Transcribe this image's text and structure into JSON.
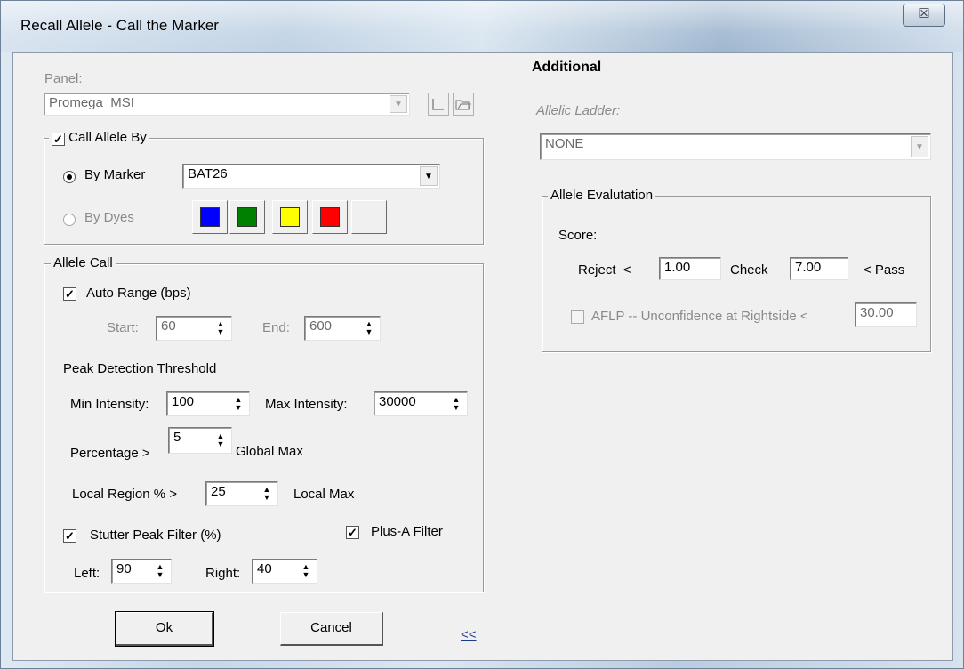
{
  "window": {
    "title": "Recall Allele - Call the Marker",
    "close_glyph": "☒"
  },
  "panel": {
    "label": "Panel:",
    "value": "Promega_MSI"
  },
  "call_allele_by": {
    "caption": "Call Allele By",
    "checked": true,
    "by_marker_label": "By Marker",
    "by_marker_selected": true,
    "marker_value": "BAT26",
    "by_dyes_label": "By Dyes",
    "dye_colors": [
      "#0000ff",
      "#008000",
      "#ffff00",
      "#ff0000",
      "#f0f0f0"
    ]
  },
  "allele_call": {
    "caption": "Allele Call",
    "auto_range_label": "Auto Range (bps)",
    "auto_range_checked": true,
    "start_label": "Start:",
    "start_value": "60",
    "end_label": "End:",
    "end_value": "600",
    "peak_threshold_label": "Peak Detection Threshold",
    "min_intensity_label": "Min Intensity:",
    "min_intensity_value": "100",
    "max_intensity_label": "Max Intensity:",
    "max_intensity_value": "30000",
    "percentage_label": "Percentage >",
    "percentage_value": "5",
    "global_max_label": "Global Max",
    "local_region_label": "Local Region % >",
    "local_region_value": "25",
    "local_max_label": "Local Max",
    "stutter_label": "Stutter Peak Filter (%)",
    "stutter_checked": true,
    "plus_a_label": "Plus-A Filter",
    "plus_a_checked": true,
    "left_label": "Left:",
    "left_value": "90",
    "right_label": "Right:",
    "right_value": "40"
  },
  "buttons": {
    "ok": "Ok",
    "cancel": "Cancel",
    "collapse": "<<"
  },
  "additional": {
    "heading": "Additional",
    "ladder_label": "Allelic Ladder:",
    "ladder_value": "NONE",
    "evaluation_caption": "Allele Evalutation",
    "score_label": "Score:",
    "reject_label": "Reject  <",
    "reject_value": "1.00",
    "check_label": "Check",
    "check_value": "7.00",
    "pass_label": "< Pass",
    "aflp_label": "AFLP -- Unconfidence at Rightside <",
    "aflp_value": "30.00",
    "aflp_checked": false
  }
}
